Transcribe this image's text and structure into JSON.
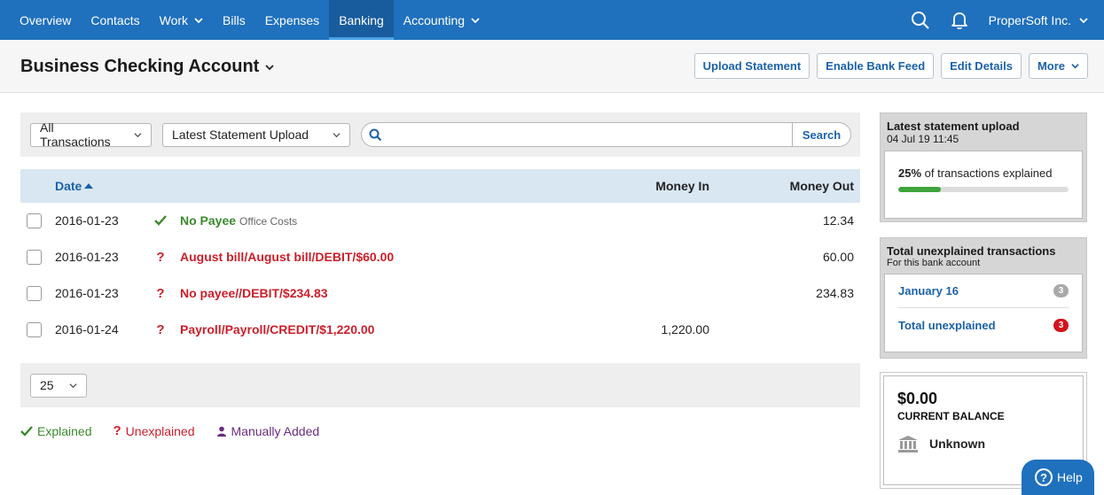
{
  "nav": {
    "items": [
      {
        "label": "Overview"
      },
      {
        "label": "Contacts"
      },
      {
        "label": "Work"
      },
      {
        "label": "Bills"
      },
      {
        "label": "Expenses"
      },
      {
        "label": "Banking"
      },
      {
        "label": "Accounting"
      }
    ],
    "active": "Banking",
    "org_name": "ProperSoft Inc."
  },
  "header": {
    "title": "Business Checking Account",
    "buttons": {
      "upload": "Upload Statement",
      "bank_feed": "Enable Bank Feed",
      "edit": "Edit Details",
      "more": "More"
    }
  },
  "filters": {
    "type_value": "All Transactions",
    "range_value": "Latest Statement Upload",
    "search_placeholder": "",
    "search_button": "Search"
  },
  "table": {
    "headers": {
      "date": "Date",
      "money_in": "Money In",
      "money_out": "Money Out"
    },
    "rows": [
      {
        "date": "2016-01-23",
        "status": "explained",
        "desc": "No Payee",
        "sub": "Office Costs",
        "in": "",
        "out": "12.34"
      },
      {
        "date": "2016-01-23",
        "status": "unexplained",
        "desc": "August bill/August bill/DEBIT/$60.00",
        "sub": "",
        "in": "",
        "out": "60.00"
      },
      {
        "date": "2016-01-23",
        "status": "unexplained",
        "desc": "No payee//DEBIT/$234.83",
        "sub": "",
        "in": "",
        "out": "234.83"
      },
      {
        "date": "2016-01-24",
        "status": "unexplained",
        "desc": "Payroll/Payroll/CREDIT/$1,220.00",
        "sub": "",
        "in": "1,220.00",
        "out": ""
      }
    ]
  },
  "pager": {
    "per_page": "25"
  },
  "legend": {
    "explained": "Explained",
    "unexplained": "Unexplained",
    "manual": "Manually Added"
  },
  "statement": {
    "title": "Latest statement upload",
    "datetime": "04 Jul 19 11:45",
    "percent_label": "25%",
    "percent_suffix": "of transactions explained",
    "percent_value": 25
  },
  "unexplained": {
    "title": "Total unexplained transactions",
    "subtitle": "For this bank account",
    "month_label": "January 16",
    "month_count": "3",
    "total_label": "Total unexplained",
    "total_count": "3"
  },
  "balance": {
    "amount": "$0.00",
    "label": "CURRENT BALANCE",
    "bank_name": "Unknown"
  },
  "help": {
    "label": "Help"
  },
  "colors": {
    "nav_bg": "#1f70bd",
    "link": "#1b62a9",
    "explained": "#3b8a2d",
    "unexplained": "#cc1f2a",
    "manual": "#6a2b82"
  }
}
